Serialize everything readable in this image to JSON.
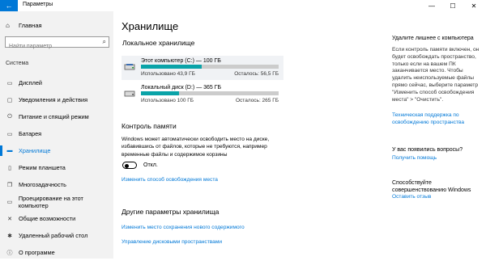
{
  "window": {
    "title": "Параметры",
    "back_icon": "←",
    "minimize_icon": "—",
    "maximize_icon": "☐",
    "close_icon": "✕"
  },
  "sidebar": {
    "home_label": "Главная",
    "search_placeholder": "Найти параметр",
    "section_label": "Система",
    "items": [
      {
        "label": "Дисплей",
        "icon": "▭",
        "active": false
      },
      {
        "label": "Уведомления и действия",
        "icon": "▢",
        "active": false
      },
      {
        "label": "Питание и спящий режим",
        "icon": "⏻",
        "active": false
      },
      {
        "label": "Батарея",
        "icon": "▭",
        "active": false
      },
      {
        "label": "Хранилище",
        "icon": "▬",
        "active": true
      },
      {
        "label": "Режим планшета",
        "icon": "▯",
        "active": false
      },
      {
        "label": "Многозадачность",
        "icon": "❐",
        "active": false
      },
      {
        "label": "Проецирование на этот компьютер",
        "icon": "▭",
        "active": false
      },
      {
        "label": "Общие возможности",
        "icon": "✕",
        "active": false
      },
      {
        "label": "Удаленный рабочий стол",
        "icon": "✱",
        "active": false
      },
      {
        "label": "О программе",
        "icon": "ⓘ",
        "active": false
      }
    ]
  },
  "main": {
    "title": "Хранилище",
    "local_storage_heading": "Локальное хранилище",
    "drives": [
      {
        "name": "Этот компьютер (C:) — 100 ГБ",
        "used": "Использовано 43,9 ГБ",
        "free": "Осталось: 56,5 ГБ",
        "used_fraction": 0.439,
        "selected": true
      },
      {
        "name": "Локальный диск (D:) — 365 ГБ",
        "used": "Использовано 100 ГБ",
        "free": "Осталось: 265 ГБ",
        "used_fraction": 0.274,
        "selected": false
      }
    ],
    "storage_sense_heading": "Контроль памяти",
    "storage_sense_desc": "Windows может автоматически освободить место на диске, избавившись от файлов, которые не требуются, например временные файлы и содержимое корзины",
    "toggle_label": "Откл.",
    "change_link": "Изменить способ освобождения места",
    "other_heading": "Другие параметры хранилища",
    "other_links": [
      "Изменить место сохранения нового содержимого",
      "Управление дисковыми пространствами"
    ]
  },
  "right": {
    "cleanup_heading": "Удалите лишнее с компьютера",
    "cleanup_text": "Если контроль памяти включен, он будет освобождать пространство, только если на вашем ПК заканчивается место. Чтобы удалить неиспользуемые файлы прямо сейчас, выберите параметр \"Изменить способ освобождения места\" > \"Очистить\".",
    "cleanup_link": "Техническая поддержка по освобождению пространства",
    "questions_heading": "У вас появились вопросы?",
    "help_link": "Получить помощь",
    "improve_heading": "Способствуйте совершенствованию Windows",
    "feedback_link": "Оставить отзыв"
  },
  "colors": {
    "accent": "#0078d7",
    "bar_fill": "#0aa3a8",
    "bar_bg": "#cccccc",
    "sidebar_bg": "#f2f2f2"
  }
}
